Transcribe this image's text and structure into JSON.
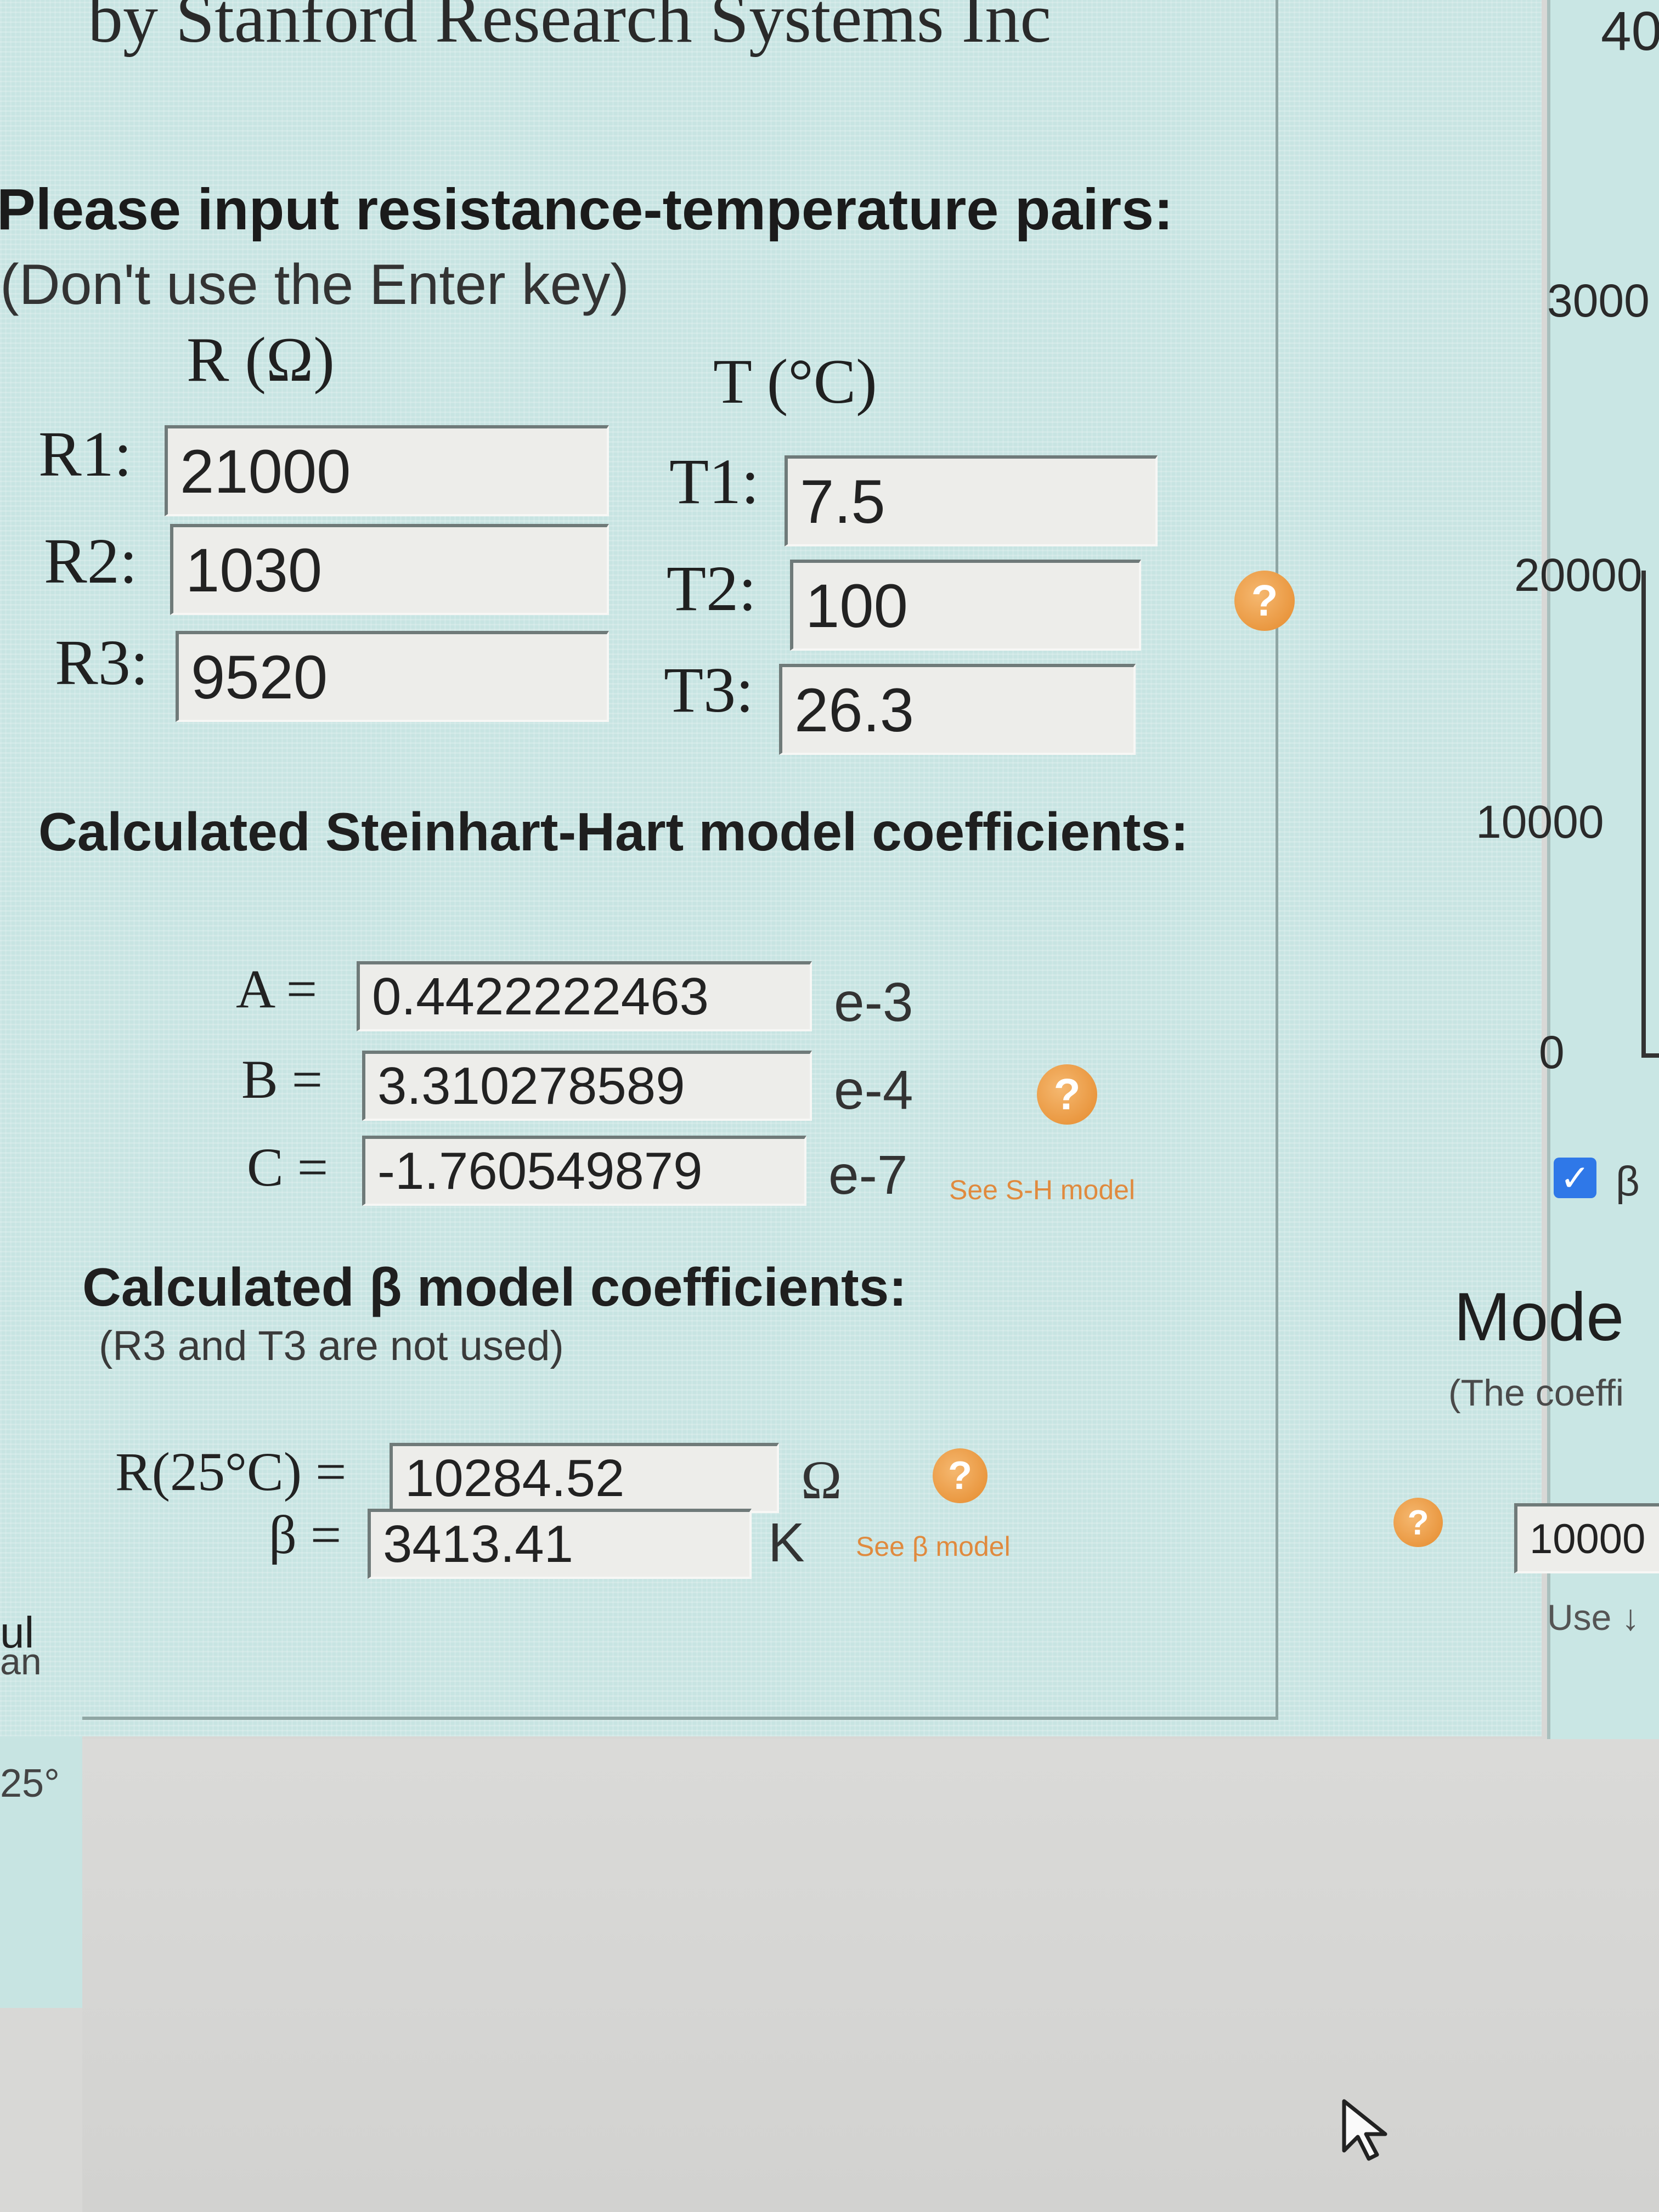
{
  "app": {
    "vendor": "by Stanford Research Systems Inc"
  },
  "inputs": {
    "prompt": "Please input resistance-temperature pairs:",
    "hint": "(Don't use the Enter key)",
    "r_header": "R (Ω)",
    "t_header": "T (°C)",
    "rows": [
      {
        "r_label": "R1:",
        "r_value": "21000",
        "t_label": "T1:",
        "t_value": "7.5"
      },
      {
        "r_label": "R2:",
        "r_value": "1030",
        "t_label": "T2:",
        "t_value": "100"
      },
      {
        "r_label": "R3:",
        "r_value": "9520",
        "t_label": "T3:",
        "t_value": "26.3"
      }
    ]
  },
  "sh": {
    "title": "Calculated Steinhart-Hart model coefficients:",
    "rows": [
      {
        "label": "A =",
        "value": "0.4422222463",
        "exp": "e-3"
      },
      {
        "label": "B =",
        "value": "3.310278589",
        "exp": "e-4"
      },
      {
        "label": "C =",
        "value": "-1.760549879",
        "exp": "e-7"
      }
    ],
    "link": "See S-H model"
  },
  "beta": {
    "title": "Calculated β model coefficients:",
    "subtitle": "(R3 and T3 are not used)",
    "r25_label": "R(25°C) =",
    "r25_value": "10284.52",
    "r25_unit": "Ω",
    "beta_label": "β =",
    "beta_value": "3413.41",
    "beta_unit": "K",
    "link": "See β model"
  },
  "right_panel": {
    "top_value": "40",
    "ticks": [
      "3000",
      "20000",
      "10000",
      "0"
    ],
    "checkbox_label": "β",
    "checkbox_checked": true,
    "model_heading": "Mode",
    "model_hint": "(The coeffi",
    "field_value": "10000",
    "use_text": "Use ↓"
  },
  "left_edge": {
    "frag1": "ul",
    "frag2": "an",
    "frag3": "25°"
  },
  "colors": {
    "panel_bg": "#c7e4e2",
    "help_icon": "#e58a2c",
    "checkbox": "#2f78e8"
  }
}
